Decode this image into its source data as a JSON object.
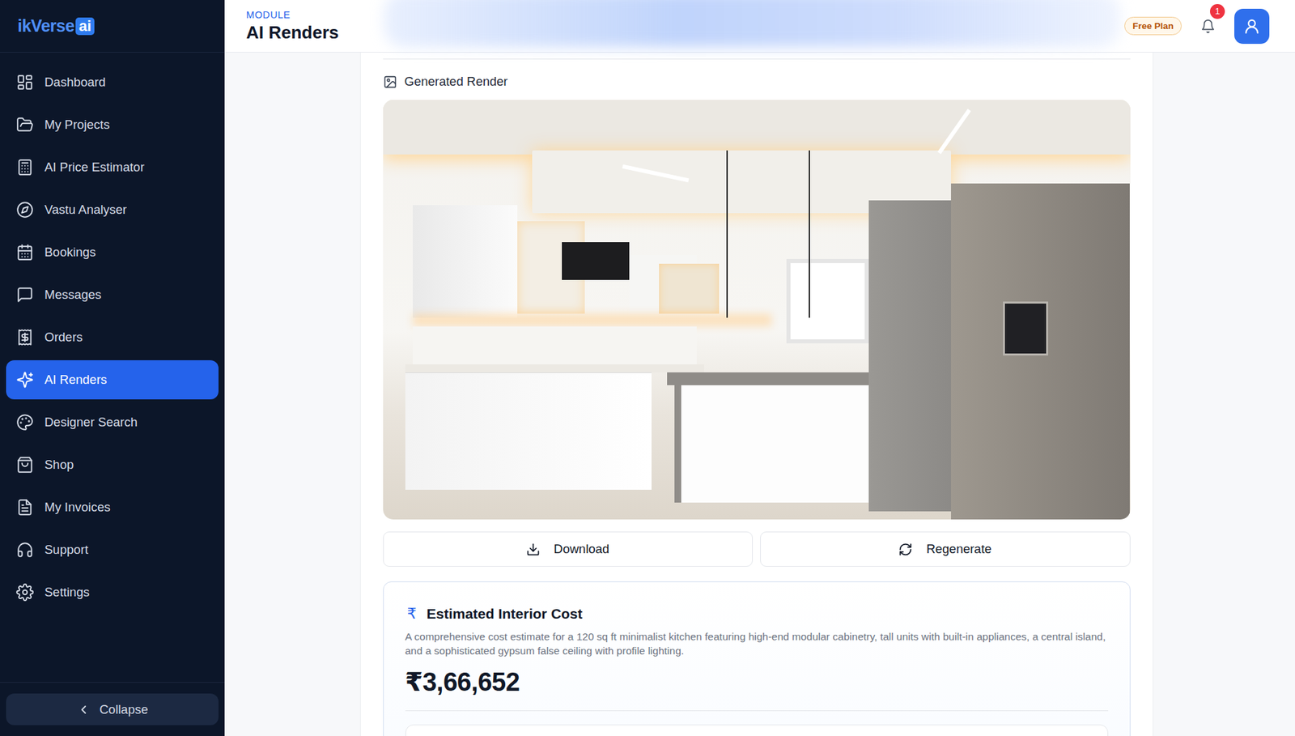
{
  "logo": {
    "text": "ikVerse",
    "badge": "ai"
  },
  "header": {
    "eyebrow": "MODULE",
    "title": "AI Renders",
    "plan": "Free Plan",
    "notifications": "1"
  },
  "sidebar": {
    "items": [
      {
        "label": "Dashboard",
        "selected": false
      },
      {
        "label": "My Projects",
        "selected": false
      },
      {
        "label": "AI Price Estimator",
        "selected": false
      },
      {
        "label": "Vastu Analyser",
        "selected": false
      },
      {
        "label": "Bookings",
        "selected": false
      },
      {
        "label": "Messages",
        "selected": false
      },
      {
        "label": "Orders",
        "selected": false
      },
      {
        "label": "AI Renders",
        "selected": true
      },
      {
        "label": "Designer Search",
        "selected": false
      },
      {
        "label": "Shop",
        "selected": false
      },
      {
        "label": "My Invoices",
        "selected": false
      },
      {
        "label": "Support",
        "selected": false
      },
      {
        "label": "Settings",
        "selected": false
      }
    ],
    "collapse": "Collapse"
  },
  "render": {
    "title": "Generated Render",
    "buttons": [
      "Download",
      "Regenerate"
    ]
  },
  "cost": {
    "icon": "₹",
    "title": "Estimated Interior Cost",
    "description": "A comprehensive cost estimate for a 120 sq ft minimalist kitchen featuring high-end modular cabinetry, tall units with built-in appliances, a central island, and a sophisticated gypsum false ceiling with profile lighting.",
    "amount": "₹3,66,652"
  }
}
